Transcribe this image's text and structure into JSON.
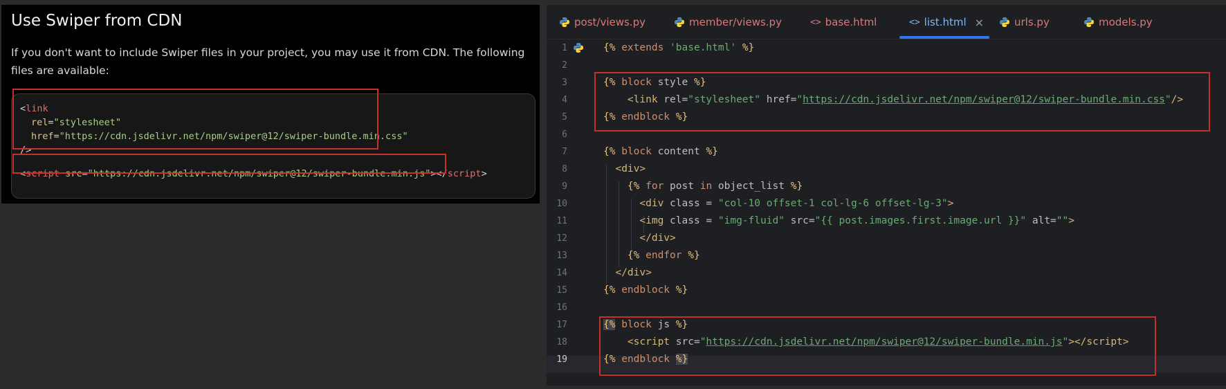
{
  "doc": {
    "title": "Use Swiper from CDN",
    "description": "If you don't want to include Swiper files in your project, you may use it from CDN. The following files are available:",
    "code": {
      "link_open": "<",
      "link_tag": "link",
      "rel_attr": "rel",
      "rel_val": "\"stylesheet\"",
      "href_attr": "href",
      "href_val": "\"https://cdn.jsdelivr.net/npm/swiper@12/swiper-bundle.min.css\"",
      "link_close": "/>",
      "script_tag": "script",
      "src_attr": "src",
      "src_val": "\"https://cdn.jsdelivr.net/npm/swiper@12/swiper-bundle.min.js\"",
      "script_end": "script"
    }
  },
  "editor": {
    "tabs": [
      {
        "label": "post/views.py",
        "icon": "python-icon"
      },
      {
        "label": "member/views.py",
        "icon": "python-icon"
      },
      {
        "label": "base.html",
        "icon": "html-icon"
      },
      {
        "label": "list.html",
        "icon": "html-icon",
        "active": true
      },
      {
        "label": "urls.py",
        "icon": "python-icon"
      },
      {
        "label": "models.py",
        "icon": "python-icon"
      }
    ],
    "close_glyph": "×",
    "line_numbers": [
      "1",
      "2",
      "3",
      "4",
      "5",
      "6",
      "7",
      "8",
      "9",
      "10",
      "11",
      "12",
      "13",
      "14",
      "15",
      "16",
      "17",
      "18",
      "19"
    ],
    "current_line": "19",
    "colors": {
      "highlight": "#c4302b",
      "active_tab": "#3574f0",
      "background": "#1e1f22"
    }
  }
}
